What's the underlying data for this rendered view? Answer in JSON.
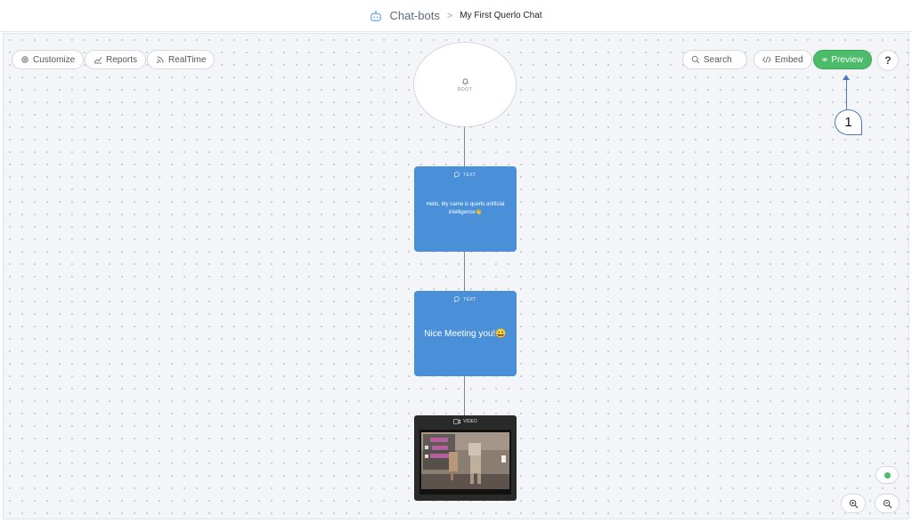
{
  "breadcrumb": {
    "root": "Chat-bots",
    "separator": ">",
    "current": "My First Querlo Chat"
  },
  "toolbar_left": {
    "customize": "Customize",
    "reports": "Reports",
    "realtime": "RealTime"
  },
  "toolbar_right": {
    "search": "Search",
    "embed": "Embed",
    "preview": "Preview",
    "help": "?"
  },
  "flow": {
    "root": {
      "label": "ROOT"
    },
    "node1": {
      "type": "TEXT",
      "text": "Hello, My name is querlo artificial intelligence👋"
    },
    "node2": {
      "type": "TEXT",
      "text": "Nice Meeting you!😀"
    },
    "node3": {
      "type": "VIDEO"
    }
  },
  "annotation": {
    "number": "1"
  },
  "colors": {
    "accent_blue": "#4a90d9",
    "preview_green": "#4cbc6a",
    "annotation_blue": "#4a78b8"
  }
}
